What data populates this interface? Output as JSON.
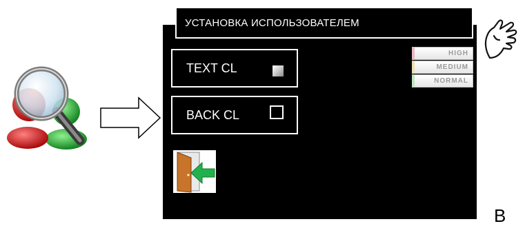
{
  "title": "УСТАНОВКА ИСПОЛЬЗОВАТЕЛЕМ",
  "options": {
    "text_color": {
      "label": "TEXT CL",
      "swatch": "filled"
    },
    "back_color": {
      "label": "BACK CL",
      "swatch": "empty"
    }
  },
  "levels": {
    "high": "HIGH",
    "medium": "MEDIUM",
    "normal": "NORMAL"
  },
  "icons": {
    "user_search": "user-search-icon",
    "arrow": "right-arrow-icon",
    "exit": "exit-door-icon",
    "hand": "pointing-hand-icon"
  },
  "colors": {
    "screen": "#000000",
    "outline": "#ffffff",
    "exit_arrow": "#22b14c",
    "door": "#c8742a",
    "level_high_accent": "#e7b9c2",
    "level_medium_accent": "#ece0b6",
    "level_normal_accent": "#bfe4c0"
  },
  "corner_text": "В"
}
